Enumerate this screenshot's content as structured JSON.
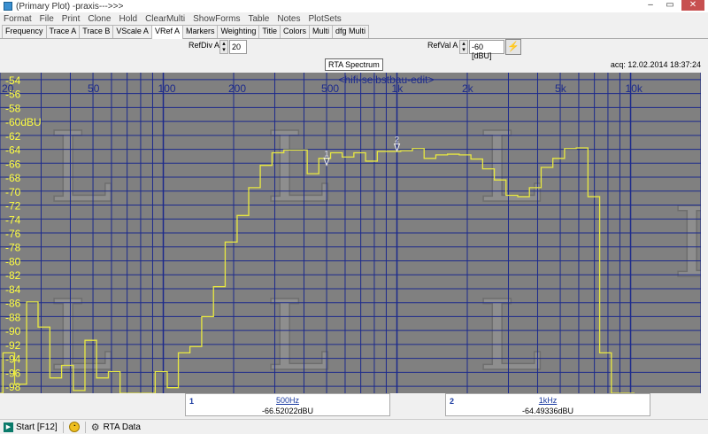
{
  "window": {
    "title": "(Primary Plot) -praxis--->>>",
    "min": "–",
    "max": "▭",
    "close": "✕"
  },
  "menu": [
    "Format",
    "File",
    "Print",
    "Clone",
    "Hold",
    "ClearMulti",
    "ShowForms",
    "Table",
    "Notes",
    "PlotSets"
  ],
  "tabs": [
    "Frequency",
    "Trace A",
    "Trace B",
    "VScale A",
    "VRef A",
    "Markers",
    "Weighting",
    "Title",
    "Colors",
    "Multi",
    "dfg Multi"
  ],
  "active_tab": 4,
  "controls": {
    "refdiv_label": "RefDiv A",
    "refdiv_value": "20",
    "refval_label": "RefVal A",
    "refval_value": "-60 [dBU]"
  },
  "plot": {
    "title": "RTA Spectrum",
    "subtitle": "<hifi-selbstbau-edit>",
    "acq": "acq: 12.02.2014 18:37:24",
    "colors": {
      "background": "#808080",
      "grid": "#1c2a8c",
      "trace": "#e8e840",
      "labels": "#ffff40",
      "freqlabels": "#1c2a8c"
    }
  },
  "chart_data": {
    "type": "line",
    "xscale": "log",
    "xlim": [
      20,
      20000
    ],
    "ylim": [
      -99,
      -53
    ],
    "yticks": [
      -54,
      -56,
      -58,
      -60,
      -62,
      -64,
      -66,
      -68,
      -70,
      -72,
      -74,
      -76,
      -78,
      -80,
      -82,
      -84,
      -86,
      -88,
      -90,
      -92,
      -94,
      -96,
      -98
    ],
    "ytick_labels": [
      "-54",
      "-56",
      "-58",
      "-60dBU",
      "-62",
      "-64",
      "-66",
      "-68",
      "-70",
      "-72",
      "-74",
      "-76",
      "-78",
      "-80",
      "-82",
      "-84",
      "-86",
      "-88",
      "-90",
      "-92",
      "-94",
      "-96",
      "-98"
    ],
    "xtick_labels": [
      {
        "value": 20,
        "label": "20"
      },
      {
        "value": 50,
        "label": "50"
      },
      {
        "value": 100,
        "label": "100"
      },
      {
        "value": 200,
        "label": "200"
      },
      {
        "value": 500,
        "label": "500"
      },
      {
        "value": 1000,
        "label": "1k"
      },
      {
        "value": 2000,
        "label": "2k"
      },
      {
        "value": 5000,
        "label": "5k"
      },
      {
        "value": 10000,
        "label": "10k"
      }
    ],
    "grid": true,
    "series": [
      {
        "steps": [
          [
            20,
            -100
          ],
          [
            20.6,
            -93.2
          ],
          [
            23.1,
            -97.7
          ],
          [
            26,
            -85.9
          ],
          [
            29.1,
            -89.5
          ],
          [
            32.7,
            -96.8
          ],
          [
            36.7,
            -95
          ],
          [
            41.2,
            -98.6
          ],
          [
            46.2,
            -91.4
          ],
          [
            51.8,
            -96.8
          ],
          [
            58.2,
            -95.9
          ],
          [
            65.3,
            -100
          ],
          [
            73.3,
            -100
          ],
          [
            82.2,
            -100
          ],
          [
            92.3,
            -95.9
          ],
          [
            104,
            -98.2
          ],
          [
            116,
            -93.2
          ],
          [
            130,
            -92.3
          ],
          [
            146,
            -88
          ],
          [
            164,
            -83.7
          ],
          [
            184,
            -77.3
          ],
          [
            207,
            -73.5
          ],
          [
            232,
            -69.5
          ],
          [
            260,
            -66.3
          ],
          [
            292,
            -64.5
          ],
          [
            328,
            -64.1
          ],
          [
            368,
            -64.1
          ],
          [
            413,
            -67.5
          ],
          [
            463,
            -65.3
          ],
          [
            520,
            -64.5
          ],
          [
            583,
            -65.1
          ],
          [
            654,
            -64.5
          ],
          [
            734,
            -65.7
          ],
          [
            824,
            -64.3
          ],
          [
            925,
            -64.3
          ],
          [
            1038,
            -64.2
          ],
          [
            1165,
            -63.9
          ],
          [
            1307,
            -65.3
          ],
          [
            1467,
            -64.8
          ],
          [
            1646,
            -64.7
          ],
          [
            1847,
            -64.8
          ],
          [
            2073,
            -65.4
          ],
          [
            2327,
            -66.8
          ],
          [
            2611,
            -68.4
          ],
          [
            2930,
            -70.6
          ],
          [
            3289,
            -70.8
          ],
          [
            3690,
            -69.5
          ],
          [
            4141,
            -66.6
          ],
          [
            4648,
            -65.3
          ],
          [
            5216,
            -63.9
          ],
          [
            5854,
            -63.8
          ],
          [
            6570,
            -70.8
          ],
          [
            7373,
            -93.2
          ],
          [
            8274,
            -100
          ],
          [
            9286,
            -100
          ]
        ]
      }
    ],
    "markers": [
      {
        "id": "1",
        "freq": 500,
        "level": -66.52022,
        "freq_label": "500Hz",
        "level_label": "-66.52022dBU"
      },
      {
        "id": "2",
        "freq": 1000,
        "level": -64.49336,
        "freq_label": "1kHz",
        "level_label": "-64.49336dBU"
      }
    ]
  },
  "status": {
    "start": "Start [F12]",
    "mode": "RTA Data"
  }
}
